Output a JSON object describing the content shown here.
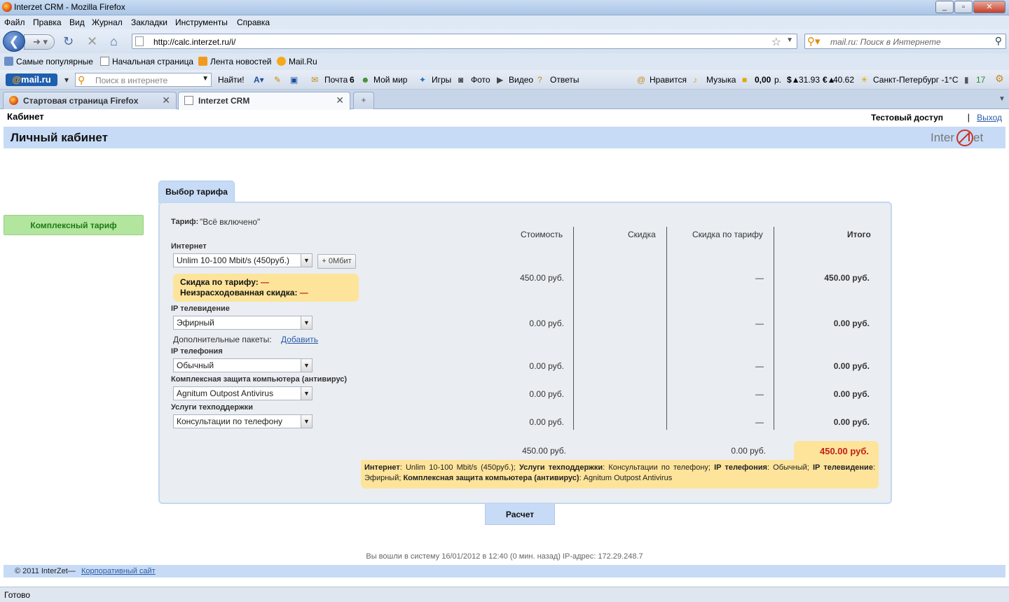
{
  "window": {
    "title": "Interzet CRM - Mozilla Firefox"
  },
  "menu": [
    "Файл",
    "Правка",
    "Вид",
    "Журнал",
    "Закладки",
    "Инструменты",
    "Справка"
  ],
  "nav": {
    "url": "http://calc.interzet.ru/i/",
    "search_placeholder": "mail.ru: Поиск в Интернете"
  },
  "bookmarks": [
    "Самые популярные",
    "Начальная страница",
    "Лента новостей",
    "Mail.Ru"
  ],
  "mailbar": {
    "logo": "mail.ru",
    "search_placeholder": "Поиск в интернете",
    "find": "Найти!",
    "mail": "Почта",
    "mail_count": "6",
    "my_world": "Мой мир",
    "games": "Игры",
    "photo": "Фото",
    "video": "Видео",
    "answers": "Ответы",
    "like": "Нравится",
    "music": "Музыка",
    "balance": "0,00",
    "balance_unit": "р.",
    "usd": "31.93",
    "eur": "40.62",
    "weather": "Санкт-Петербург -1°C",
    "traffic": "17"
  },
  "tabs": [
    {
      "label": "Стартовая страница Firefox"
    },
    {
      "label": "Interzet CRM"
    }
  ],
  "page": {
    "section": "Кабинет",
    "user": "Тестовый доступ",
    "separator": "|",
    "logout": "Выход",
    "header": "Личный кабинет",
    "logo": "Inter Zet",
    "side_button": "Комплексный тариф",
    "tab_title": "Выбор тарифа",
    "tariff_label": "Тариф:",
    "tariff_name": "\"Всё включено\"",
    "columns": [
      "Стоимость",
      "Скидка",
      "Скидка по тарифу",
      "Итого"
    ],
    "internet": {
      "label": "Интернет",
      "value": "Unlim 10-100 Mbit/s (450руб.)",
      "plus": "+ 0Мбит",
      "cost": "450.00 руб.",
      "tariff_disc": "—",
      "total": "450.00 руб."
    },
    "discount_box": {
      "line1": "Скидка по тарифу:",
      "line2": "Неизрасходованная скидка:",
      "dash": "—"
    },
    "iptv": {
      "label": "IP телевидение",
      "value": "Эфирный",
      "cost": "0.00 руб.",
      "tariff_disc": "—",
      "total": "0.00 руб."
    },
    "extra": {
      "label": "Дополнительные пакеты:",
      "link": "Добавить"
    },
    "phone": {
      "label": "IP телефония",
      "value": "Обычный",
      "cost": "0.00 руб.",
      "tariff_disc": "—",
      "total": "0.00 руб."
    },
    "antivirus": {
      "label": "Комплексная защита компьютера (антивирус)",
      "value": "Agnitum Outpost Antivirus",
      "cost": "0.00 руб.",
      "tariff_disc": "—",
      "total": "0.00 руб."
    },
    "support": {
      "label": "Услуги техподдержки",
      "value": "Консультации по телефону",
      "cost": "0.00 руб.",
      "tariff_disc": "—",
      "total": "0.00 руб."
    },
    "sum_cost": "450.00 руб.",
    "sum_tariff_disc": "0.00 руб.",
    "sum_total": "450.00 руб.",
    "summary": [
      {
        "k": "Интернет",
        "v": ": Unlim 10-100 Mbit/s (450руб.); "
      },
      {
        "k": "Услуги техподдержки",
        "v": ": Консультации по телефону; "
      },
      {
        "k": "IP телефония",
        "v": ": Обычный; "
      },
      {
        "k": "IP телевидение",
        "v": ": Эфирный; "
      },
      {
        "k": "Комплексная защита компьютера (антивирус)",
        "v": ": Agnitum Outpost Antivirus"
      }
    ],
    "calc_button": "Расчет",
    "login_info": "Вы вошли в систему 16/01/2012 в 12:40 (0 мин. назад) IP-адрес: 172.29.248.7",
    "copyright": "© 2011 InterZet—",
    "corporate": "Корпоративный сайт"
  },
  "status": "Готово",
  "colors": {
    "accent": "#c7dbf6",
    "highlight": "#fde49a",
    "green": "#b2e59d",
    "red": "#c0201a"
  }
}
